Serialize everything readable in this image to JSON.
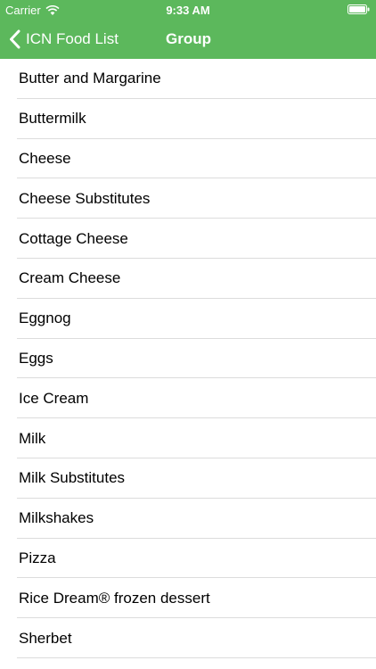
{
  "status_bar": {
    "carrier": "Carrier",
    "time": "9:33 AM",
    "wifi_icon": "wifi-icon",
    "battery_icon": "battery-icon"
  },
  "nav": {
    "back_label": "ICN Food List",
    "back_icon": "chevron-left-icon",
    "title": "Group",
    "bar_color": "#5cb85c"
  },
  "list": {
    "items": [
      {
        "label": "Butter and Margarine"
      },
      {
        "label": "Buttermilk"
      },
      {
        "label": "Cheese"
      },
      {
        "label": "Cheese Substitutes"
      },
      {
        "label": "Cottage Cheese"
      },
      {
        "label": "Cream Cheese"
      },
      {
        "label": "Eggnog"
      },
      {
        "label": "Eggs"
      },
      {
        "label": "Ice Cream"
      },
      {
        "label": "Milk"
      },
      {
        "label": "Milk Substitutes"
      },
      {
        "label": "Milkshakes"
      },
      {
        "label": "Pizza"
      },
      {
        "label": "Rice Dream® frozen dessert"
      },
      {
        "label": "Sherbet"
      }
    ]
  }
}
